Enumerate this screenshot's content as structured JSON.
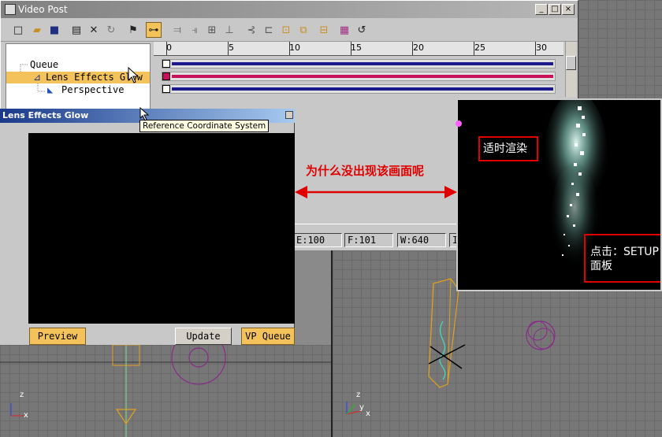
{
  "window": {
    "title": "Video Post",
    "minimize_glyph": "_",
    "maximize_glyph": "□",
    "close_glyph": "×"
  },
  "toolbar": {
    "icons": [
      "new-sequence-icon",
      "open-sequence-icon",
      "save-sequence-icon",
      "edit-event-icon",
      "delete-event-icon",
      "swap-events-icon",
      "execute-sequence-icon",
      "edit-range-bar-icon",
      "align-left-icon",
      "align-right-icon",
      "make-same-size-icon",
      "abut-clips-icon",
      "add-scene-event-icon",
      "add-image-input-event-icon",
      "add-image-filter-event-icon",
      "add-image-layer-event-icon",
      "add-image-output-event-icon",
      "add-external-event-icon",
      "add-loop-event-icon"
    ]
  },
  "queue": {
    "root_label": "Queue",
    "items": [
      {
        "label": "Lens Effects Glow",
        "selected": true
      },
      {
        "label": "Perspective",
        "selected": false
      }
    ]
  },
  "timeline": {
    "ruler_labels": [
      "0",
      "5",
      "10",
      "15",
      "20",
      "25",
      "30"
    ],
    "tracks": [
      {
        "color": "#1a1a8c"
      },
      {
        "color": "#c8105a"
      },
      {
        "color": "#1a1a8c"
      }
    ]
  },
  "glow_dialog": {
    "title": "Lens Effects Glow",
    "preview_label": "Preview",
    "update_label": "Update",
    "vp_queue_label": "VP Queue"
  },
  "tooltip": {
    "text": "Reference Coordinate System"
  },
  "status": {
    "end": "E:100",
    "frames": "F:101",
    "width": "W:640",
    "partial": "I"
  },
  "annotations": {
    "question": "为什么没出现该画面呢",
    "realtime_render": "适时渲染",
    "click_setup": "点击：SETUP",
    "click_setup_line2": "面板"
  },
  "axes": {
    "x": "x",
    "y": "y",
    "z": "z"
  },
  "colors": {
    "accent": "#f3c25a",
    "annotation_red": "#e00000",
    "glow_title": "#1a3a8a"
  }
}
